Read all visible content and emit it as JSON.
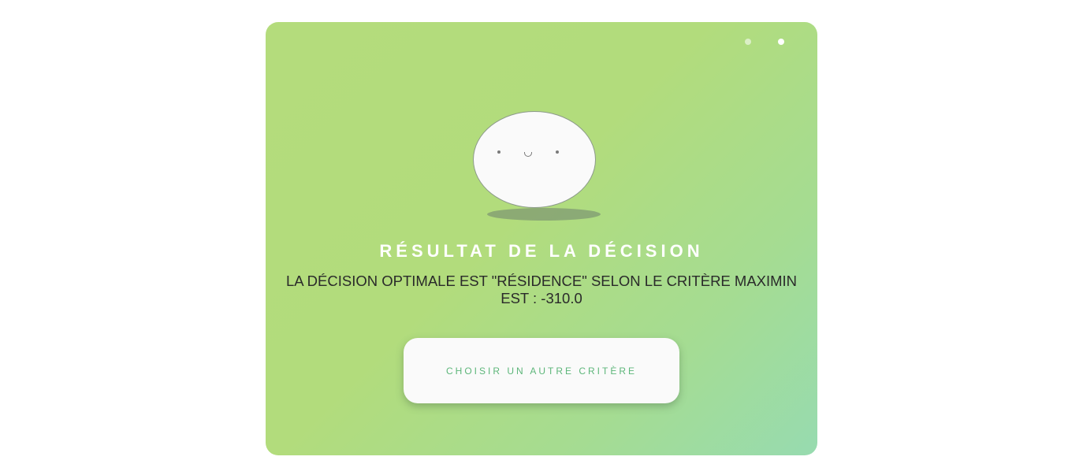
{
  "pagination": {
    "total": 2,
    "active_index": 1
  },
  "mascot": {
    "expression": "smiling-face"
  },
  "result": {
    "title": "RÉSULTAT DE LA DÉCISION",
    "message": "LA DÉCISION OPTIMALE EST \"RÉSIDENCE\" SELON LE CRITÈRE MAXIMIN EST : -310.0"
  },
  "actions": {
    "choose_other_label": "CHOISIR UN AUTRE CRITÈRE"
  },
  "colors": {
    "gradient_start": "#b4dc7c",
    "gradient_end": "#97dbb0",
    "button_text": "#5db67a",
    "title_text": "#ffffff"
  }
}
